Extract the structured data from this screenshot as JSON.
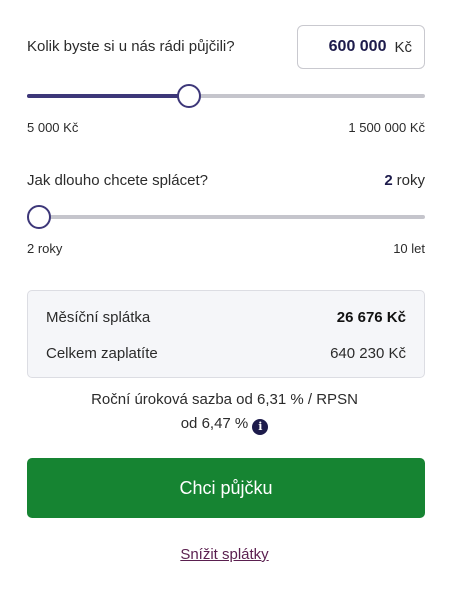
{
  "loan_amount": {
    "question": "Kolik byste si u nás rádi půjčili?",
    "value": "600 000",
    "unit": "Kč",
    "min_label": "5 000 Kč",
    "max_label": "1 500 000 Kč",
    "slider_fraction": 0.4
  },
  "loan_term": {
    "question": "Jak dlouho chcete splácet?",
    "value": "2",
    "unit": "roky",
    "min_label": "2 roky",
    "max_label": "10 let",
    "slider_fraction": 0.0
  },
  "summary": {
    "monthly_label": "Měsíční splátka",
    "monthly_value": "26 676 Kč",
    "total_label": "Celkem zaplatíte",
    "total_value": "640 230 Kč"
  },
  "rate_info": {
    "line1": "Roční úroková sazba od 6,31 % / RPSN",
    "line2": "od 6,47 %",
    "info_icon": "info-icon"
  },
  "cta": {
    "label": "Chci půjčku"
  },
  "secondary_link": {
    "label": "Snížit splátky"
  },
  "colors": {
    "accent": "#3d3779",
    "cta": "#168432",
    "link": "#5a1f4f"
  }
}
